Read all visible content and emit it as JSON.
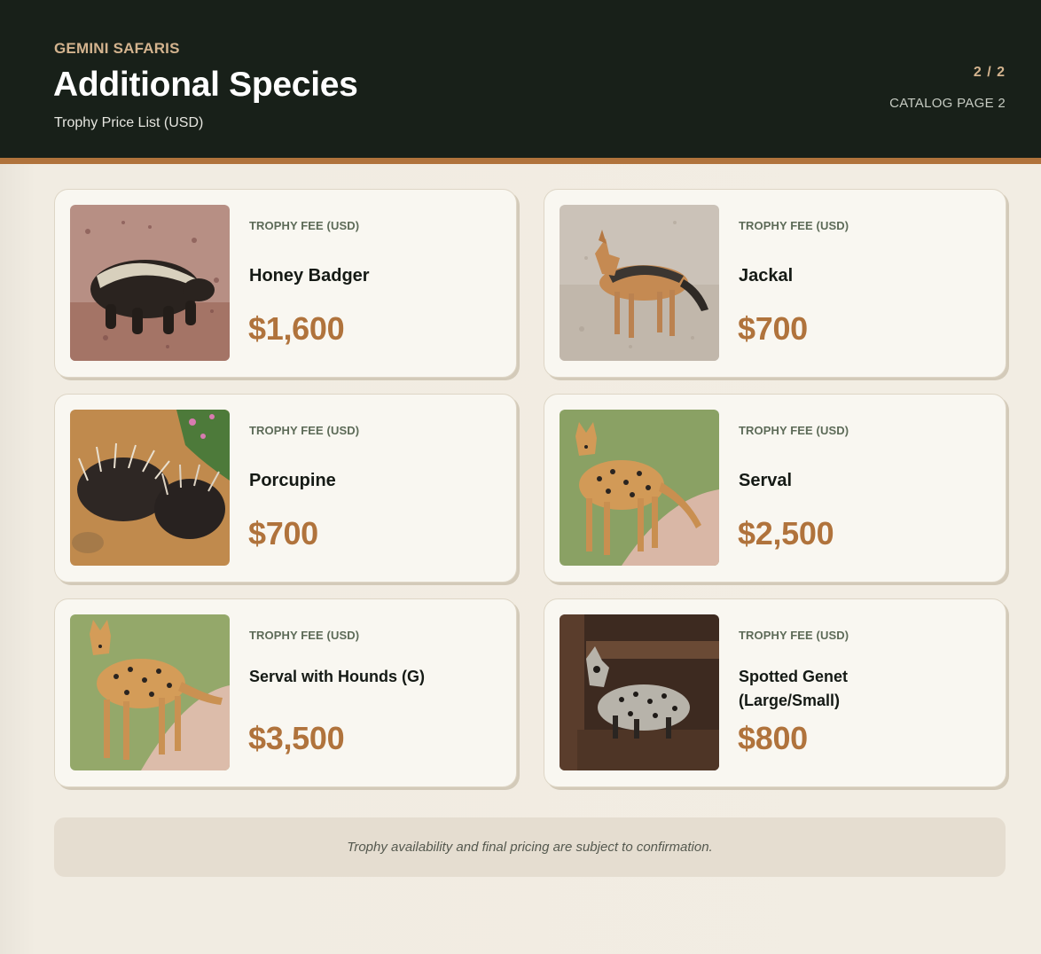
{
  "header": {
    "brand": "GEMINI SAFARIS",
    "title": "Additional Species",
    "subtitle": "Trophy Price List (USD)",
    "page_number": "2 / 2",
    "page_label": "CATALOG PAGE 2"
  },
  "colors": {
    "header_bg": "#182019",
    "accent": "#b0733c",
    "brand": "#d3b38e"
  },
  "cards": [
    {
      "fee_label": "TROPHY FEE (USD)",
      "species": "Honey Badger",
      "price": "$1,600",
      "photo": "honey-badger-photo"
    },
    {
      "fee_label": "TROPHY FEE (USD)",
      "species": "Jackal",
      "price": "$700",
      "photo": "jackal-photo"
    },
    {
      "fee_label": "TROPHY FEE (USD)",
      "species": "Porcupine",
      "price": "$700",
      "photo": "porcupine-photo"
    },
    {
      "fee_label": "TROPHY FEE (USD)",
      "species": "Serval",
      "price": "$2,500",
      "photo": "serval-photo"
    },
    {
      "fee_label": "TROPHY FEE (USD)",
      "species": "Serval with Hounds (G)",
      "price": "$3,500",
      "photo": "serval-photo"
    },
    {
      "fee_label": "TROPHY FEE (USD)",
      "species": "Spotted Genet (Large/Small)",
      "price": "$800",
      "photo": "spotted-genet-photo"
    }
  ],
  "footer": {
    "note": "Trophy availability and final pricing are subject to confirmation."
  }
}
